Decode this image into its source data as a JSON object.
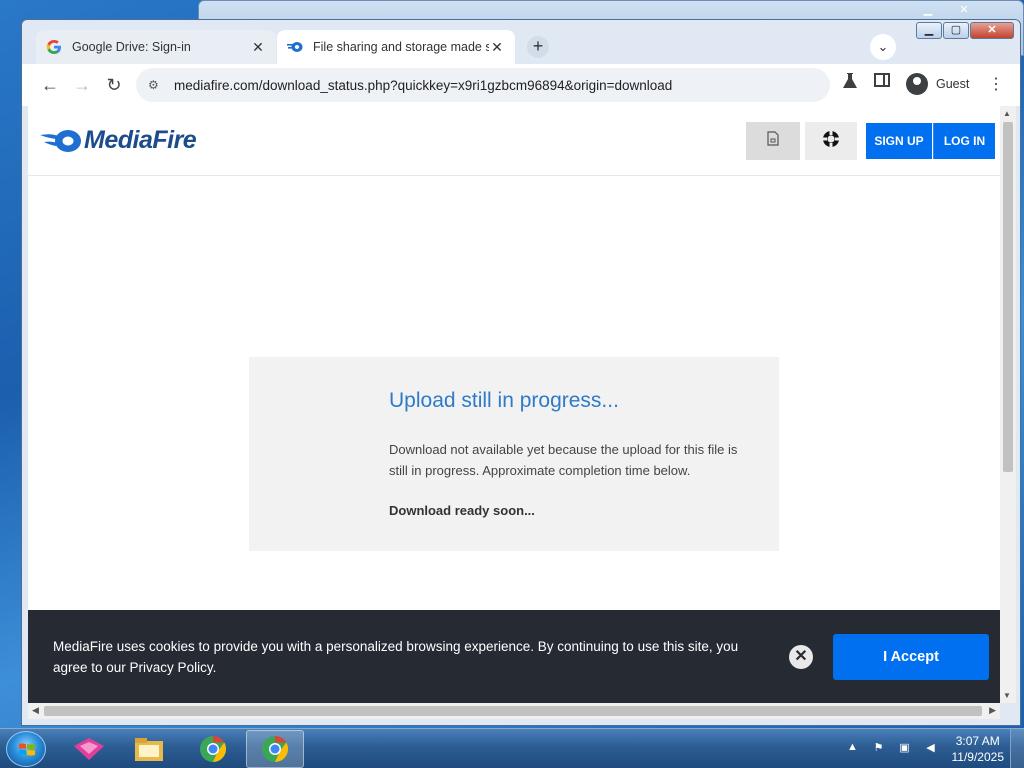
{
  "browser": {
    "tabs": [
      {
        "title": "Google Drive: Sign-in",
        "favicon": "google-g-icon",
        "active": false
      },
      {
        "title": "File sharing and storage made s",
        "favicon": "mediafire-icon",
        "active": true
      }
    ],
    "address": {
      "url": "mediafire.com/download_status.php?quickkey=x9ri1gzbcm96894&origin=download"
    },
    "profile_label": "Guest"
  },
  "page": {
    "header": {
      "logo_text": "MediaFire",
      "signup_label": "SIGN UP",
      "login_label": "LOG IN"
    },
    "status": {
      "heading": "Upload still in progress...",
      "body": "Download not available yet because the upload for this file is still in progress. Approximate completion time below.",
      "sub": "Download ready soon..."
    },
    "cookie": {
      "message": "MediaFire uses cookies to provide you with a personalized browsing experience. By continuing to use this site, you agree to our Privacy Policy.",
      "close_glyph": "✕",
      "accept_label": "I Accept"
    }
  },
  "taskbar": {
    "time": "3:07 AM",
    "date": "11/9/2025"
  },
  "colors": {
    "accent_blue": "#0070f0",
    "heading_blue": "#2f7ac9",
    "cookie_bg": "#262b33",
    "logo_blue": "#1d4c8c"
  }
}
